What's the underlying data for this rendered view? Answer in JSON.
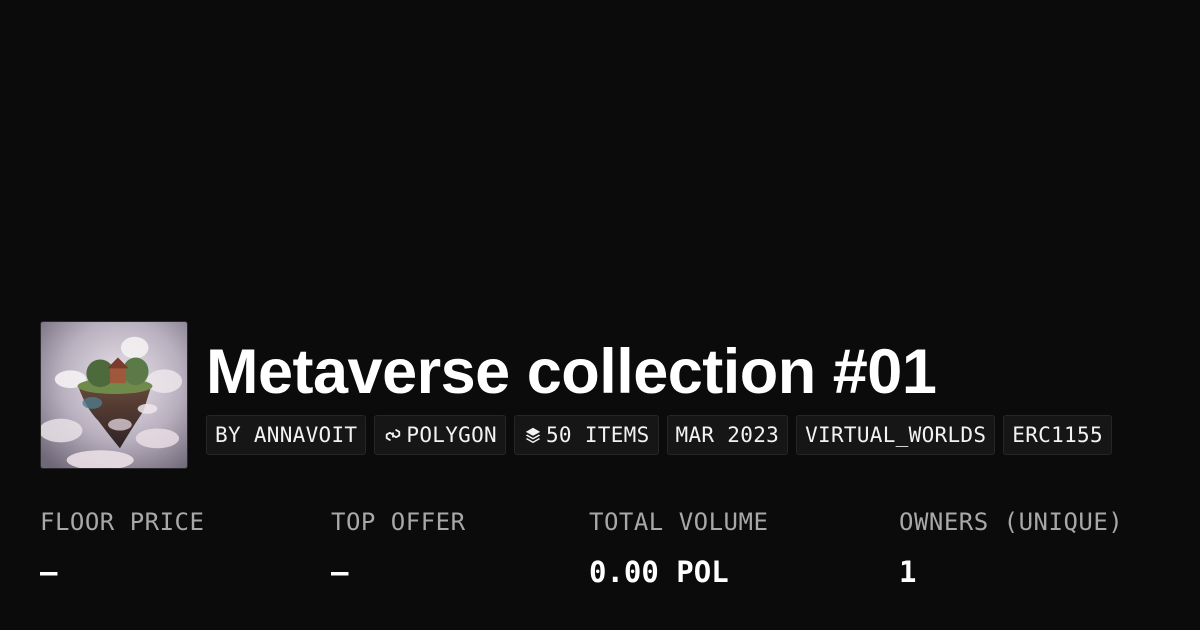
{
  "collection": {
    "title": "Metaverse collection #01",
    "thumbnail_icon": "floating-island-artwork"
  },
  "tags": [
    {
      "label": "BY ANNAVOIT",
      "icon": ""
    },
    {
      "label": "POLYGON",
      "icon": "polygon-chain-icon"
    },
    {
      "label": "50 ITEMS",
      "icon": "layers-icon"
    },
    {
      "label": "MAR 2023",
      "icon": ""
    },
    {
      "label": "VIRTUAL_WORLDS",
      "icon": ""
    },
    {
      "label": "ERC1155",
      "icon": ""
    }
  ],
  "stats": [
    {
      "label": "FLOOR PRICE",
      "value": "–"
    },
    {
      "label": "TOP OFFER",
      "value": "–"
    },
    {
      "label": "TOTAL VOLUME",
      "value": "0.00 POL"
    },
    {
      "label": "OWNERS (UNIQUE)",
      "value": "1"
    }
  ],
  "colors": {
    "background": "#0b0b0b",
    "tag_background": "#161616",
    "label_gray": "#a8a8a8",
    "text": "#ffffff"
  }
}
